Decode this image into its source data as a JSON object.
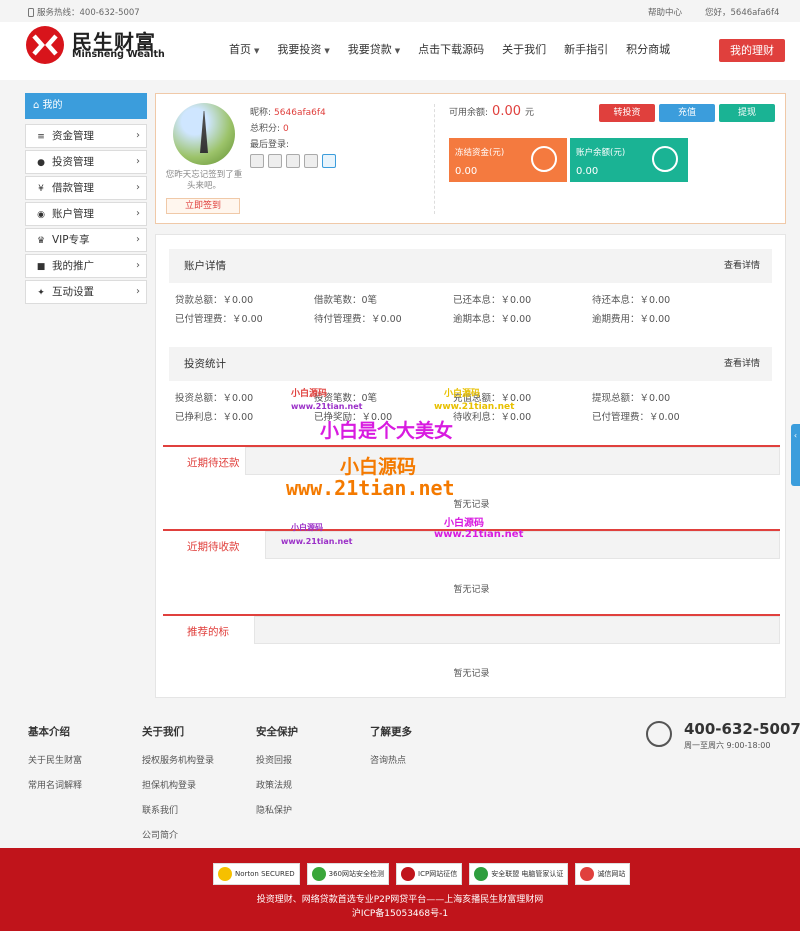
{
  "topbar": {
    "hotline": "服务热线：400-632-5007",
    "help": "帮助中心",
    "greeting": "您好，5646afa6f4"
  },
  "header": {
    "logo_cn": "民生财富",
    "logo_en": "Minsheng Wealth",
    "nav": [
      {
        "label": "首页",
        "dropdown": true
      },
      {
        "label": "我要投资",
        "dropdown": true
      },
      {
        "label": "我要贷款",
        "dropdown": true
      },
      {
        "label": "点击下载源码",
        "dropdown": false
      },
      {
        "label": "关于我们",
        "dropdown": false
      },
      {
        "label": "新手指引",
        "dropdown": false
      },
      {
        "label": "积分商城",
        "dropdown": false
      }
    ],
    "my_wealth": "我的理财",
    "accent": "#e0403d"
  },
  "sidebar": {
    "head": "我的",
    "items": [
      {
        "label": "资金管理",
        "icon": "database-icon"
      },
      {
        "label": "投资管理",
        "icon": "money-bag-icon"
      },
      {
        "label": "借款管理",
        "icon": "yen-icon"
      },
      {
        "label": "账户管理",
        "icon": "user-icon"
      },
      {
        "label": "VIP专享",
        "icon": "crown-icon"
      },
      {
        "label": "我的推广",
        "icon": "gift-icon"
      },
      {
        "label": "互动设置",
        "icon": "puzzle-icon"
      }
    ]
  },
  "user": {
    "nickname_label": "昵称:",
    "nickname": "5646afa6f4",
    "points_label": "总积分:",
    "points": "0",
    "last_login_label": "最后登录:",
    "sign_text": "您昨天忘记签到了重头来吧。",
    "sign_button": "立即签到",
    "available_label": "可用余额:",
    "available_amount": "0.00",
    "available_unit": "元",
    "actions": [
      {
        "label": "转投资",
        "color": "#e0403d"
      },
      {
        "label": "充值",
        "color": "#3b9ddc"
      },
      {
        "label": "提现",
        "color": "#1ab394"
      }
    ],
    "tiles": [
      {
        "label": "冻结资金(元)",
        "value": "0.00",
        "color": "#f47a3f"
      },
      {
        "label": "账户余额(元)",
        "value": "0.00",
        "color": "#1ab394"
      }
    ]
  },
  "account_detail": {
    "title": "账户详情",
    "more": "查看详情",
    "rows": [
      [
        "贷款总额：￥0.00",
        "借款笔数：0笔",
        "已还本息：￥0.00",
        "待还本息：￥0.00"
      ],
      [
        "已付管理费：￥0.00",
        "待付管理费：￥0.00",
        "逾期本息：￥0.00",
        "逾期费用：￥0.00"
      ]
    ]
  },
  "invest_stats": {
    "title": "投资统计",
    "more": "查看详情",
    "rows": [
      [
        "投资总额：￥0.00",
        "投资笔数：0笔",
        "充值总额：￥0.00",
        "提现总额：￥0.00"
      ],
      [
        "已挣利息：￥0.00",
        "已挣奖励：￥0.00",
        "待收利息：￥0.00",
        "已付管理费：￥0.00"
      ]
    ]
  },
  "records": [
    {
      "title": "近期待还款",
      "empty": "暂无记录"
    },
    {
      "title": "近期待收款",
      "empty": "暂无记录"
    },
    {
      "title": "推荐的标",
      "empty": "暂无记录"
    }
  ],
  "watermarks": {
    "big_title": "小白是个大美女",
    "source": "小白源码",
    "url": "www.21tian.net"
  },
  "footer": {
    "cols": [
      {
        "title": "基本介绍",
        "links": [
          "关于民生财富",
          "常用名词解释"
        ]
      },
      {
        "title": "关于我们",
        "links": [
          "授权服务机构登录",
          "担保机构登录",
          "联系我们",
          "公司简介"
        ]
      },
      {
        "title": "安全保护",
        "links": [
          "投资回报",
          "政策法规",
          "隐私保护"
        ]
      },
      {
        "title": "了解更多",
        "links": [
          "咨询热点"
        ]
      }
    ],
    "hotline": "400-632-5007",
    "hours": "周一至周六 9:00-18:00"
  },
  "bottom": {
    "badges": [
      "Norton SECURED",
      "360网站安全检测",
      "ICP网站征信",
      "安全联盟 电脑管家认证",
      "诚信网站"
    ],
    "line1": "投资理财、网络贷款首选专业P2P网贷平台——上海亥播民生财富理财网",
    "line2": "沪ICP备15053468号-1"
  }
}
